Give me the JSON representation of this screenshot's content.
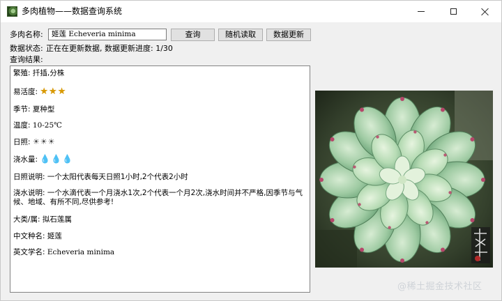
{
  "window": {
    "title": "多肉植物——数据查询系统",
    "icon": "succulent-app-icon"
  },
  "form": {
    "name_label": "多肉名称:",
    "name_value": "姬莲 Echeveria minima",
    "query_button": "查询",
    "random_button": "随机读取",
    "update_button": "数据更新"
  },
  "status": {
    "label": "数据状态:",
    "text": "正在在更新数据, 数据更新进度: 1/30",
    "progress": "1/30"
  },
  "result": {
    "label": "查询结果:",
    "propagation_label": "繁殖:",
    "propagation_value": "扦插,分株",
    "ease_label": "易活度:",
    "ease_rating": 3,
    "ease_symbols": "★★★",
    "season_label": "季节:",
    "season_value": "夏种型",
    "temperature_label": "温度:",
    "temperature_value": "10-25℃",
    "sunlight_label": "日照:",
    "sunlight_rating": 3,
    "sunlight_symbols": "☀☀☀",
    "watering_label": "浇水量:",
    "watering_rating": 3,
    "watering_symbols": "💧💧💧",
    "sun_note_label": "日照说明:",
    "sun_note_value": "一个太阳代表每天日照1小时,2个代表2小时",
    "water_note_label": "浇水说明:",
    "water_note_value": "一个水滴代表一个月浇水1次,2个代表一个月2次,浇水时间并不严格,因季节与气候、地域、有所不同,尽供参考!",
    "genus_label": "大类/属:",
    "genus_value": "拟石莲属",
    "cn_name_label": "中文种名:",
    "cn_name_value": "姬莲",
    "en_name_label": "英文学名:",
    "en_name_value": "Echeveria minima"
  },
  "photo": {
    "subject": "echeveria-rosette-photo"
  },
  "watermark": "@稀土掘金技术社区"
}
